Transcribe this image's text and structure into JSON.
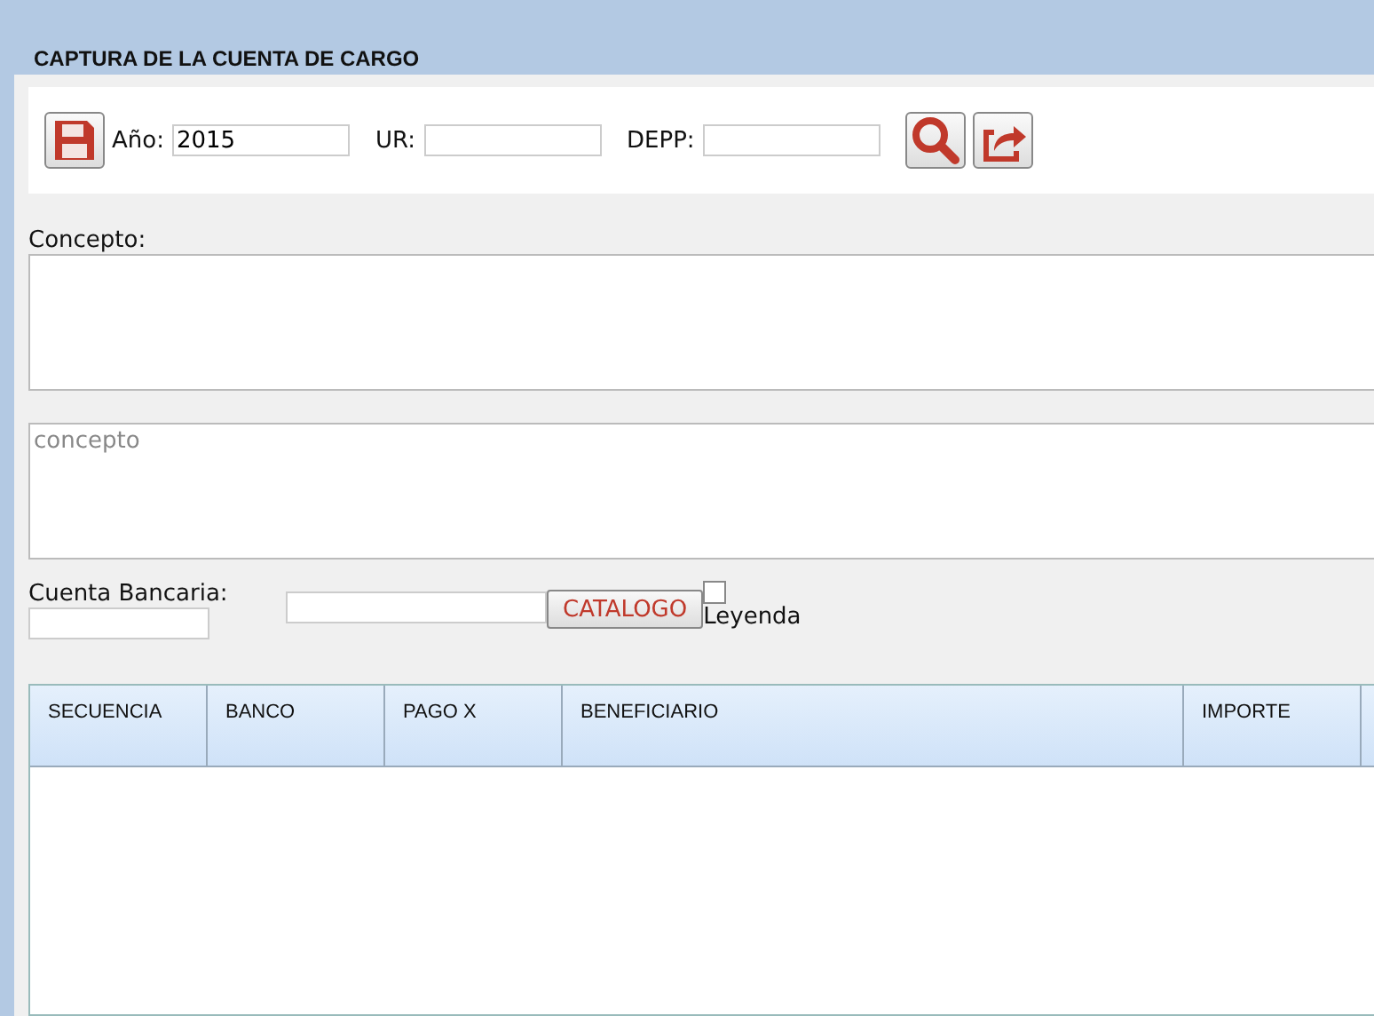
{
  "window": {
    "title": "CAPTURA DE LA CUENTA DE CARGO"
  },
  "toolbar": {
    "year_label": "Año:",
    "year_value": "2015",
    "ur_label": "UR:",
    "depp_label": "DEPP:"
  },
  "concepto": {
    "label": "Concepto:"
  },
  "concepto2": {
    "placeholder": "concepto"
  },
  "cuenta": {
    "label": "Cuenta Bancaria:",
    "catalog_button": "CATALOGO",
    "leyenda_label": "Leyenda",
    "leyenda_checked": false
  },
  "table": {
    "columns": [
      "SECUENCIA",
      "BANCO",
      "PAGO X",
      "BENEFICIARIO",
      "IMPORTE"
    ]
  }
}
